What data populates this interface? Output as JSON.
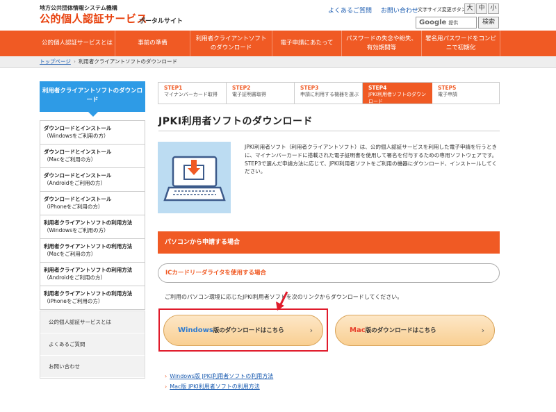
{
  "header": {
    "logo_sub": "地方公共団体情報システム機構",
    "logo_main": "公的個人認証サービス",
    "logo_portal": "ポータルサイト",
    "link_faq": "よくあるご質問",
    "link_contact": "お問い合わせ",
    "fontsize_label": "文字サイズ変更ボタン",
    "fontsize_large": "大",
    "fontsize_medium": "中",
    "fontsize_small": "小",
    "search_brand": "Google",
    "search_placeholder": "提供",
    "search_button": "検索"
  },
  "nav": [
    {
      "label": "公的個人認証サービスとは"
    },
    {
      "label": "事前の準備"
    },
    {
      "label": "利用者クライアントソフト\nのダウンロード"
    },
    {
      "label": "電子申請にあたって"
    },
    {
      "label": "パスワードの失念や紛失、\n有効期間等"
    },
    {
      "label": "署名用パスワードをコンピ\nニで初期化"
    }
  ],
  "breadcrumb": {
    "home": "トップページ",
    "separator": "›",
    "current": "利用者クライアントソフトのダウンロード"
  },
  "sidebar": {
    "heading": "利用者クライアントソフトのダウンロード",
    "items": [
      {
        "main": "ダウンロードとインストール",
        "sub": "（Windowsをご利用の方）"
      },
      {
        "main": "ダウンロードとインストール",
        "sub": "（Macをご利用の方）"
      },
      {
        "main": "ダウンロードとインストール",
        "sub": "（Androidをご利用の方）"
      },
      {
        "main": "ダウンロードとインストール",
        "sub": "（iPhoneをご利用の方）"
      },
      {
        "main": "利用者クライアントソフトの利用方法",
        "sub": "（Windowsをご利用の方）"
      },
      {
        "main": "利用者クライアントソフトの利用方法",
        "sub": "（Macをご利用の方）"
      },
      {
        "main": "利用者クライアントソフトの利用方法",
        "sub": "（Androidをご利用の方）"
      },
      {
        "main": "利用者クライアントソフトの利用方法",
        "sub": "（iPhoneをご利用の方）"
      }
    ],
    "bottom": [
      {
        "label": "公的個人認証サービスとは"
      },
      {
        "label": "よくあるご質問"
      },
      {
        "label": "お問い合わせ"
      }
    ]
  },
  "steps": [
    {
      "num": "STEP1",
      "label": "マイナンバーカード取得"
    },
    {
      "num": "STEP2",
      "label": "電子証明書取得"
    },
    {
      "num": "STEP3",
      "label": "申請に利用する機器を選ぶ"
    },
    {
      "num": "STEP4",
      "label": "JPKI利用者ソフトのダウンロード"
    },
    {
      "num": "STEP5",
      "label": "電子申請"
    }
  ],
  "main": {
    "title": "JPKI利用者ソフトのダウンロード",
    "intro_p1": "JPKI利用者ソフト（利用者クライアントソフト）は、公的個人認証サービスを利用した電子申請を行うときに、マイナンバーカードに搭載された電子証明書を使用して署名を付与するための専用ソフトウェアです。",
    "intro_p2": "STEP3で選んだ申請方法に応じて、JPKI利用者ソフトをご利用の機器にダウンロード、インストールしてください。",
    "section_heading": "パソコンから申請する場合",
    "sub_heading": "ICカードリーダライタを使用する場合",
    "sub_text": "ご利用のパソコン環境に応じたJPKI利用者ソフトを次のリンクからダウンロードしてください。",
    "btn_windows_os": "Windows",
    "btn_windows_rest": "版のダウンロードはこちら",
    "btn_mac_os": "Mac",
    "btn_mac_rest": "版のダウンロードはこちら",
    "btn_chevron": "›",
    "link_windows": "Windows版 JPKI利用者ソフトの利用方法",
    "link_mac": "Mac版 JPKI利用者ソフトの利用方法",
    "link_chevron": "›"
  },
  "colors": {
    "brand_orange": "#f05a24",
    "sidebar_blue": "#2e9be6",
    "highlight_red": "#e01b2b"
  }
}
